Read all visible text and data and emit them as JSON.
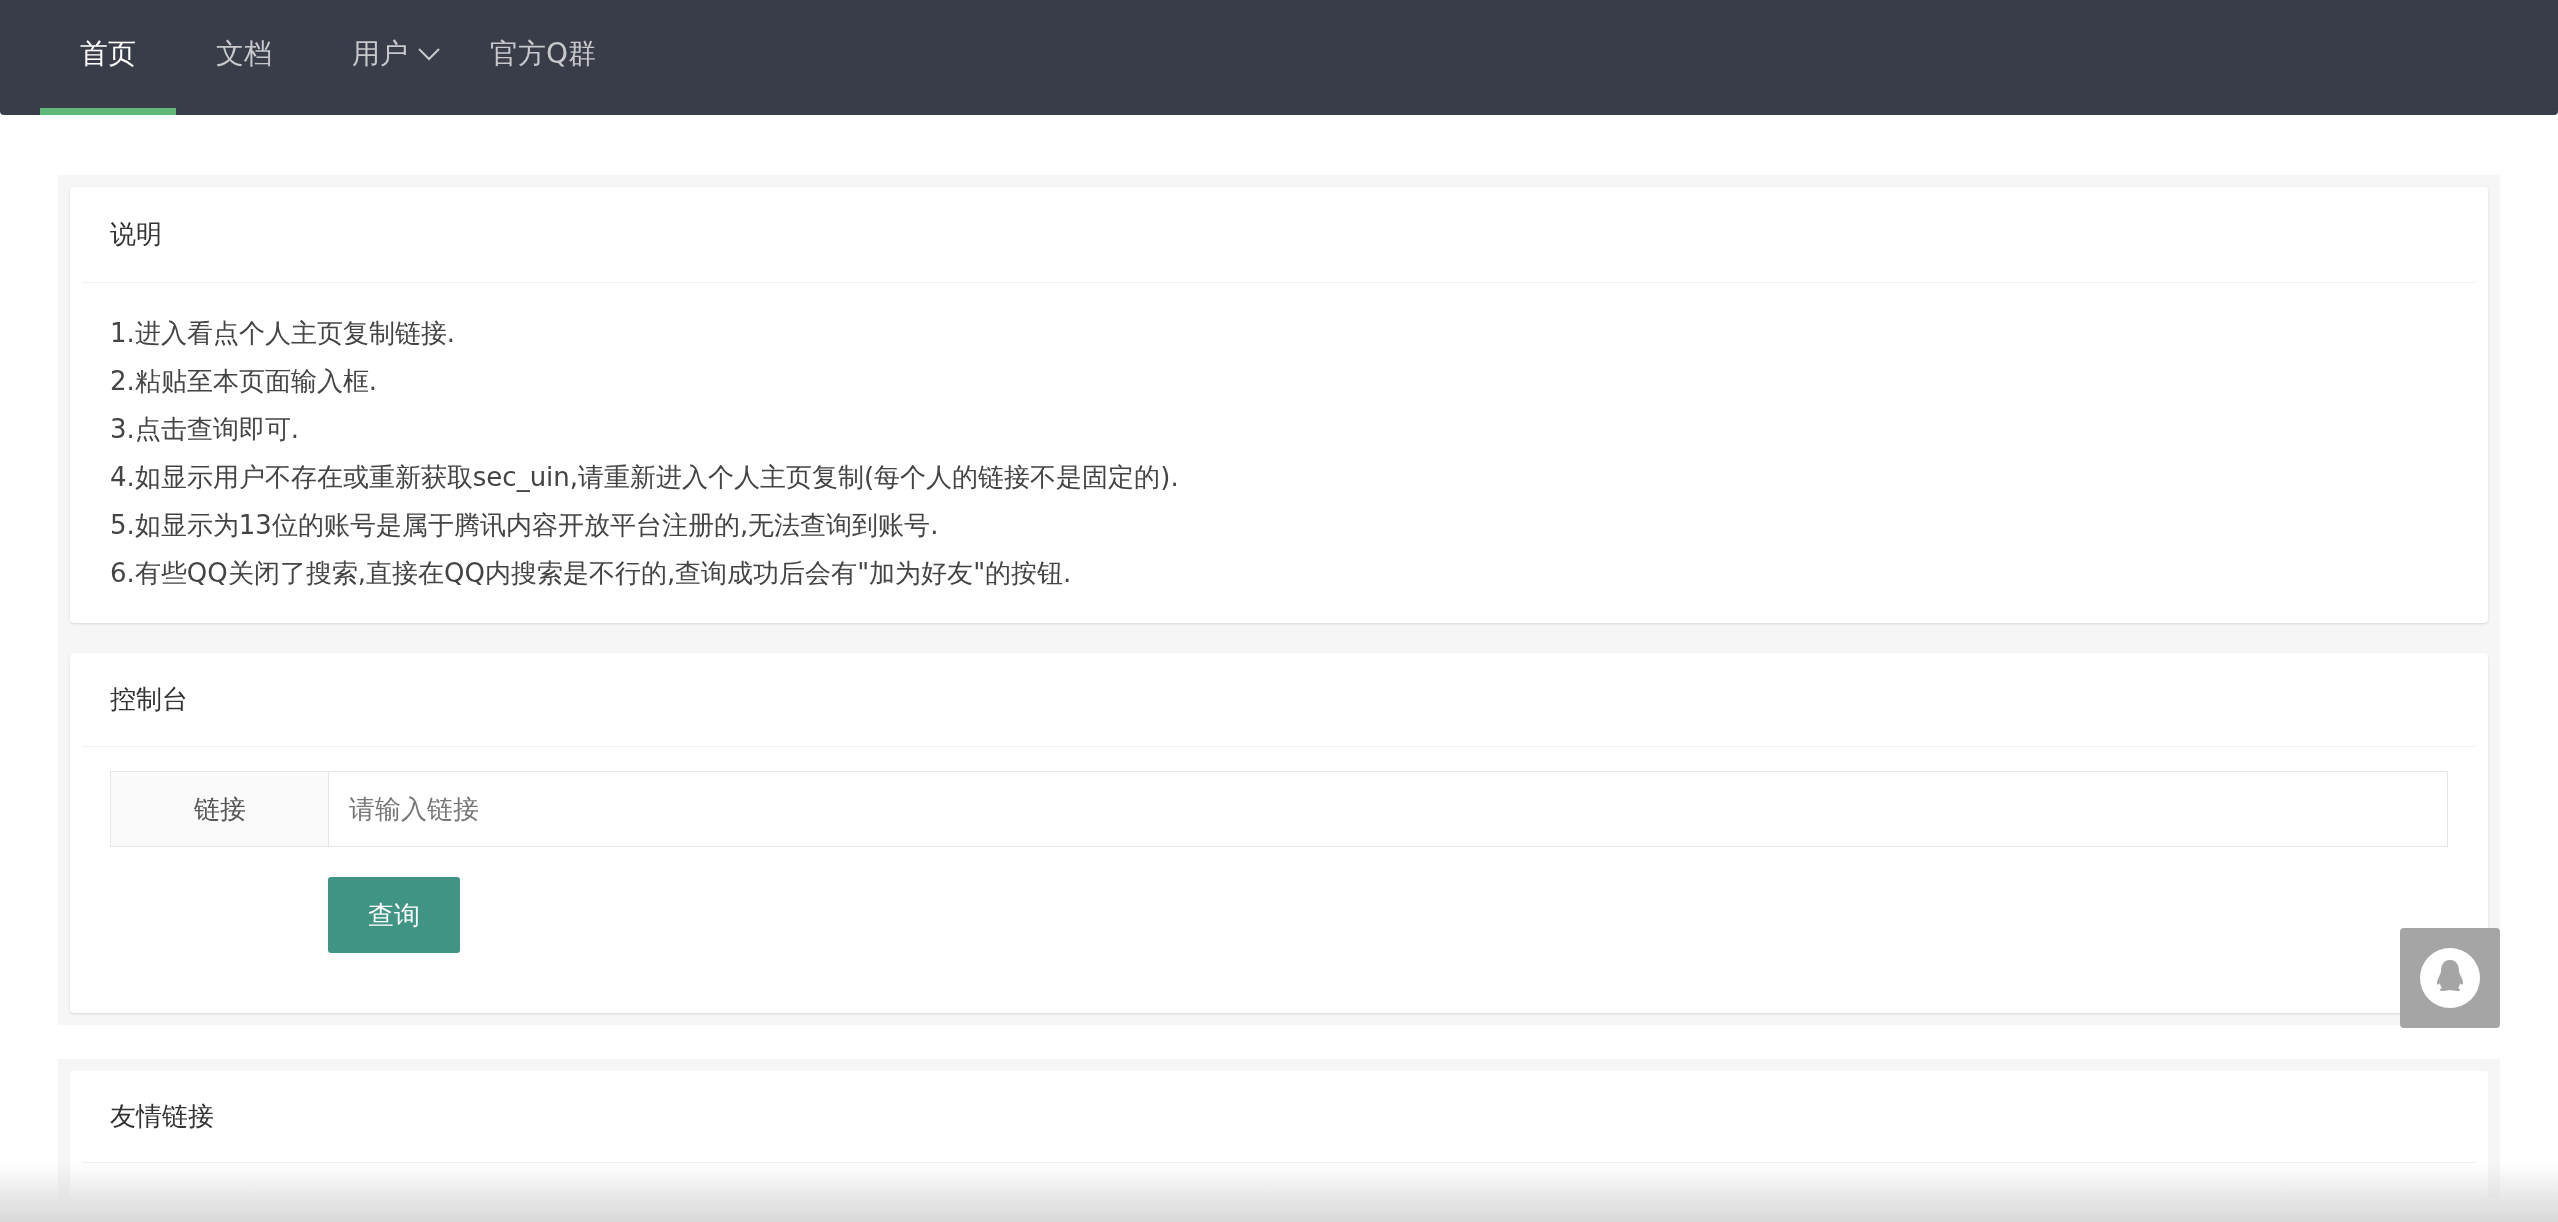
{
  "nav": {
    "tabs": [
      {
        "label": "首页",
        "selected": true,
        "dropdown": false
      },
      {
        "label": "文档",
        "selected": false,
        "dropdown": false
      },
      {
        "label": "用户",
        "selected": false,
        "dropdown": true
      },
      {
        "label": "官方Q群",
        "selected": false,
        "dropdown": false
      }
    ]
  },
  "instructions": {
    "title": "说明",
    "lines": [
      "1.进入看点个人主页复制链接.",
      "2.粘贴至本页面输入框.",
      "3.点击查询即可.",
      "4.如显示用户不存在或重新获取sec_uin,请重新进入个人主页复制(每个人的链接不是固定的).",
      "5.如显示为13位的账号是属于腾讯内容开放平台注册的,无法查询到账号.",
      "6.有些QQ关闭了搜索,直接在QQ内搜索是不行的,查询成功后会有\"加为好友\"的按钮."
    ]
  },
  "console": {
    "title": "控制台",
    "field_label": "链接",
    "placeholder": "请输入链接",
    "button": "查询"
  },
  "links": {
    "title": "友情链接"
  }
}
